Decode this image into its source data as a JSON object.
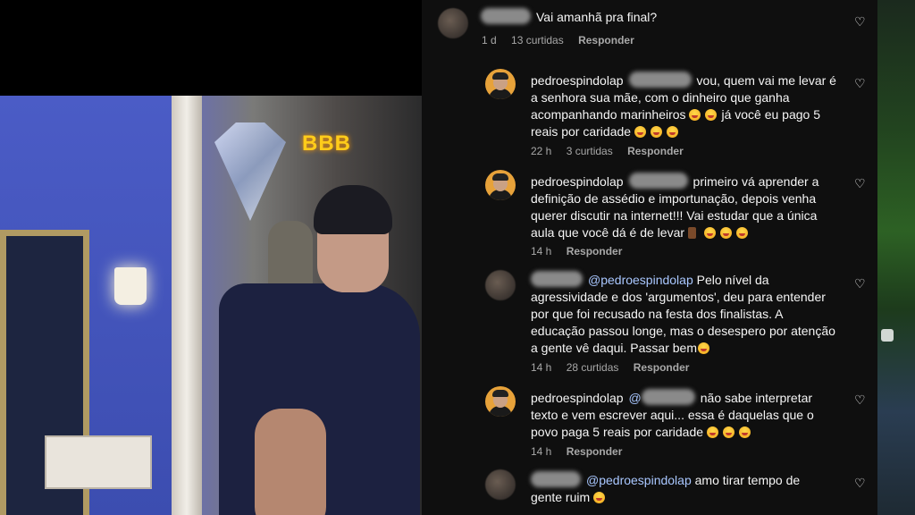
{
  "video": {
    "logo_text": "BBB"
  },
  "comments": [
    {
      "username": "",
      "username_blurred": true,
      "text": "Vai amanhã pra final?",
      "time": "1 d",
      "likes": "13 curtidas",
      "reply_label": "Responder"
    },
    {
      "username": "pedroespindolap",
      "text_a": "vou, quem vai me levar é",
      "text_b": "a senhora sua mãe, com o dinheiro que ganha",
      "text_c": "acompanhando marinheiros",
      "text_d": "já você eu pago 5",
      "text_e": "reais por caridade",
      "time": "22 h",
      "likes": "3 curtidas",
      "reply_label": "Responder"
    },
    {
      "username": "pedroespindolap",
      "text_a": "primeiro vá aprender a",
      "text_b": "definição de assédio e importunação, depois venha",
      "text_c": "querer discutir na internet!!! Vai estudar que a única",
      "text_d": "aula que você dá é de levar",
      "time": "14 h",
      "reply_label": "Responder"
    },
    {
      "mention": "@pedroespindolap",
      "text_a": "Pelo nível da",
      "text_b": "agressividade e dos 'argumentos', deu para entender",
      "text_c": "por que foi recusado na festa dos finalistas. A",
      "text_d": "educação passou longe, mas o desespero por atenção",
      "text_e": "a gente vê daqui. Passar bem",
      "time": "14 h",
      "likes": "28 curtidas",
      "reply_label": "Responder"
    },
    {
      "username": "pedroespindolap",
      "text_a": "não sabe interpretar",
      "text_b": "texto e vem escrever aqui... essa é daquelas que o",
      "text_c": "povo paga 5 reais por caridade",
      "time": "14 h",
      "reply_label": "Responder"
    },
    {
      "mention": "@pedroespindolap",
      "text_a": "amo tirar tempo de",
      "text_b": "gente ruim"
    }
  ],
  "icons": {
    "like": "heart-outline-icon"
  }
}
